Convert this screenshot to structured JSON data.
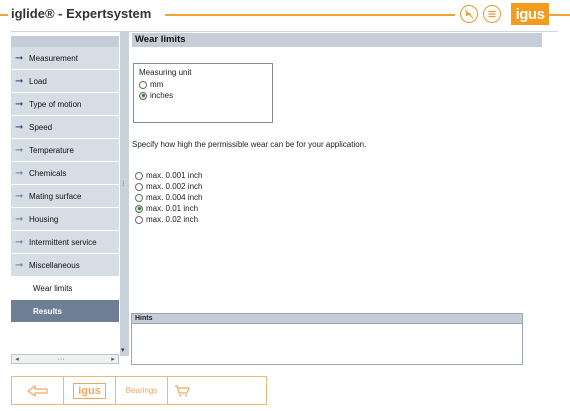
{
  "header": {
    "title": "iglide® - Expertsystem",
    "icons": [
      "play-icon",
      "list-icon"
    ],
    "logo_text": "igus"
  },
  "sidebar": {
    "items": [
      {
        "label": "Measurement",
        "state": "done"
      },
      {
        "label": "Load",
        "state": "done"
      },
      {
        "label": "Type of motion",
        "state": "done"
      },
      {
        "label": "Speed",
        "state": "done"
      },
      {
        "label": "Temperature",
        "state": "open"
      },
      {
        "label": "Chemicals",
        "state": "open"
      },
      {
        "label": "Mating surface",
        "state": "open"
      },
      {
        "label": "Housing",
        "state": "open"
      },
      {
        "label": "Intermittent service",
        "state": "open"
      },
      {
        "label": "Miscellaneous",
        "state": "open"
      },
      {
        "label": "Wear limits",
        "state": "current"
      },
      {
        "label": "Results",
        "state": "results"
      }
    ]
  },
  "content": {
    "title": "Wear limits",
    "measuring_unit": {
      "legend": "Measuring unit",
      "options": [
        {
          "label": "mm",
          "checked": false
        },
        {
          "label": "inches",
          "checked": true
        }
      ]
    },
    "prompt": "Specify how high the permissible wear can be for your application.",
    "wear_options": [
      {
        "label": "max. 0.001 inch",
        "checked": false
      },
      {
        "label": "max. 0.002 inch",
        "checked": false
      },
      {
        "label": "max. 0.004 inch",
        "checked": false
      },
      {
        "label": "max. 0.01 inch",
        "checked": true
      },
      {
        "label": "max. 0.02 inch",
        "checked": false
      }
    ],
    "hints_label": "Hints"
  },
  "toolbar": {
    "logo_text": "igus",
    "bearings_label": "Bearings"
  }
}
